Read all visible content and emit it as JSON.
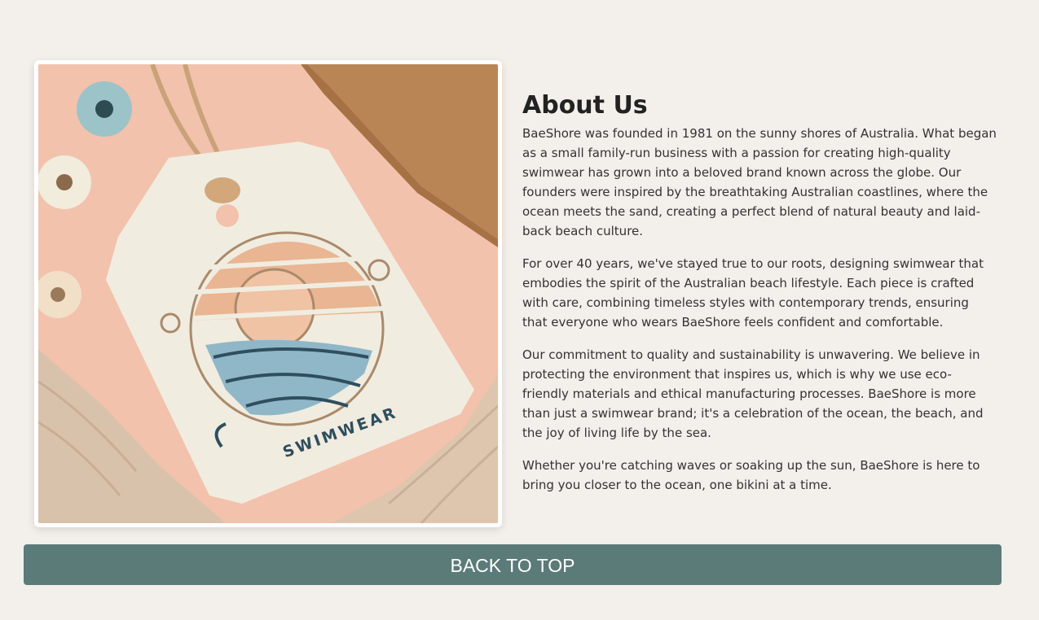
{
  "about": {
    "heading": "About Us",
    "paragraphs": [
      "BaeShore was founded in 1981 on the sunny shores of Australia. What began as a small family-run business with a passion for creating high-quality swimwear has grown into a beloved brand known across the globe. Our founders were inspired by the breathtaking Australian coastlines, where the ocean meets the sand, creating a perfect blend of natural beauty and laid-back beach culture.",
      "For over 40 years, we've stayed true to our roots, designing swimwear that embodies the spirit of the Australian beach lifestyle. Each piece is crafted with care, combining timeless styles with contemporary trends, ensuring that everyone who wears BaeShore feels confident and comfortable.",
      "Our commitment to quality and sustainability is unwavering. We believe in protecting the environment that inspires us, which is why we use eco-friendly materials and ethical manufacturing processes. BaeShore is more than just a swimwear brand; it's a celebration of the ocean, the beach, and the joy of living life by the sea.",
      "Whether you're catching waves or soaking up the sun, BaeShore is here to bring you closer to the ocean, one bikini at a time."
    ]
  },
  "photo": {
    "tag_text": "SWIMWEAR"
  },
  "footer": {
    "back_to_top_label": "BACK TO TOP"
  },
  "colors": {
    "background": "#f3efeb",
    "button": "#5b7b78",
    "button_text": "#ffffff"
  }
}
